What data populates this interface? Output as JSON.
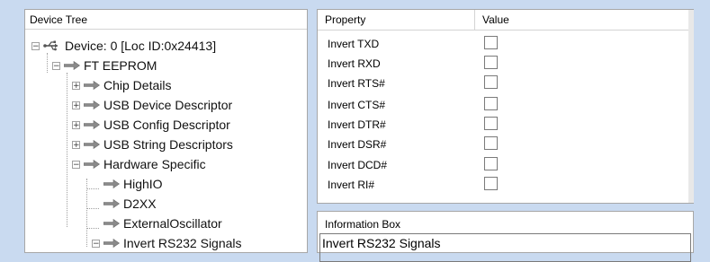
{
  "tree": {
    "header": "Device Tree",
    "nodes": [
      {
        "label": "Device: 0 [Loc ID:0x24413]",
        "expander": "−",
        "icon": "usb-icon"
      },
      {
        "label": "FT EEPROM",
        "expander": "−",
        "icon": "arrow-icon"
      },
      {
        "label": "Chip Details",
        "expander": "+",
        "icon": "arrow-icon"
      },
      {
        "label": "USB Device Descriptor",
        "expander": "+",
        "icon": "arrow-icon"
      },
      {
        "label": "USB Config Descriptor",
        "expander": "+",
        "icon": "arrow-icon"
      },
      {
        "label": "USB String Descriptors",
        "expander": "+",
        "icon": "arrow-icon"
      },
      {
        "label": "Hardware Specific",
        "expander": "−",
        "icon": "arrow-icon"
      },
      {
        "label": "HighIO",
        "expander": "",
        "icon": "arrow-icon"
      },
      {
        "label": "D2XX",
        "expander": "",
        "icon": "arrow-icon"
      },
      {
        "label": "ExternalOscillator",
        "expander": "",
        "icon": "arrow-icon"
      },
      {
        "label": "Invert RS232 Signals",
        "expander": "−",
        "icon": "arrow-icon"
      }
    ]
  },
  "properties": {
    "col_property": "Property",
    "col_value": "Value",
    "rows": [
      {
        "name": "Invert TXD",
        "checked": false
      },
      {
        "name": "Invert RXD",
        "checked": false
      },
      {
        "name": "Invert RTS#",
        "checked": false
      },
      {
        "name": "Invert CTS#",
        "checked": false
      },
      {
        "name": "Invert DTR#",
        "checked": false
      },
      {
        "name": "Invert DSR#",
        "checked": false
      },
      {
        "name": "Invert DCD#",
        "checked": false
      },
      {
        "name": "Invert RI#",
        "checked": false
      }
    ]
  },
  "info": {
    "title": "Information Box",
    "body": "Invert RS232 Signals"
  }
}
